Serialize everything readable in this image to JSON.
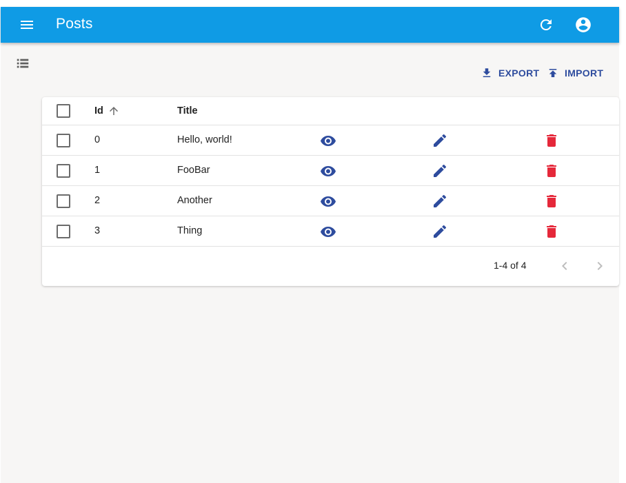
{
  "appbar": {
    "title": "Posts",
    "menu_icon": "menu-icon",
    "refresh_icon": "refresh-icon",
    "account_icon": "account-circle-icon",
    "color": "#0f9be5"
  },
  "toolbar": {
    "export_label": "EXPORT",
    "import_label": "IMPORT",
    "accent": "#2e4c9e"
  },
  "table": {
    "columns": {
      "id": "Id",
      "title": "Title"
    },
    "sort": {
      "column": "Id",
      "direction": "ascending"
    },
    "rows": [
      {
        "id": "0",
        "title": "Hello, world!"
      },
      {
        "id": "1",
        "title": "FooBar"
      },
      {
        "id": "2",
        "title": "Another"
      },
      {
        "id": "3",
        "title": "Thing"
      }
    ],
    "row_actions": [
      "eye-icon",
      "pencil-icon",
      "trash-icon"
    ],
    "delete_color": "#e5283a"
  },
  "pagination": {
    "range": "1-4 of 4"
  }
}
